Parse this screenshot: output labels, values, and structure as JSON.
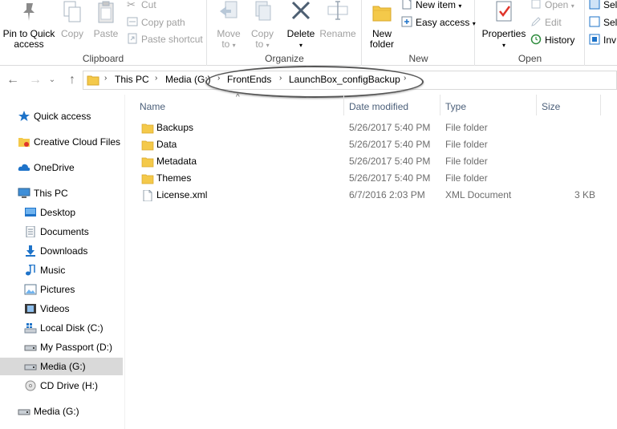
{
  "ribbon": {
    "clipboard": {
      "label": "Clipboard",
      "pin_line1": "Pin to Quick",
      "pin_line2": "access",
      "copy": "Copy",
      "paste": "Paste",
      "cut": "Cut",
      "copy_path": "Copy path",
      "paste_shortcut": "Paste shortcut"
    },
    "organize": {
      "label": "Organize",
      "move_to": "Move",
      "move_to2": "to",
      "copy_to": "Copy",
      "copy_to2": "to",
      "delete": "Delete",
      "rename": "Rename"
    },
    "new": {
      "label": "New",
      "new_folder1": "New",
      "new_folder2": "folder",
      "new_item": "New item",
      "easy_access": "Easy access"
    },
    "open": {
      "label": "Open",
      "properties": "Properties",
      "open": "Open",
      "edit": "Edit",
      "history": "History"
    },
    "select": {
      "select_all": "Sel",
      "select_none": "Sel",
      "invert": "Inv"
    }
  },
  "address": {
    "crumbs": [
      "This PC",
      "Media (G:)",
      "FrontEnds",
      "LaunchBox_configBackup"
    ]
  },
  "nav": {
    "items": [
      {
        "label": "Quick access",
        "icon": "star-icon"
      },
      {
        "label": "Creative Cloud Files",
        "icon": "creative-cloud-icon"
      },
      {
        "label": "OneDrive",
        "icon": "cloud-icon"
      },
      {
        "label": "This PC",
        "icon": "computer-icon"
      },
      {
        "label": "Desktop",
        "icon": "desktop-icon"
      },
      {
        "label": "Documents",
        "icon": "documents-icon"
      },
      {
        "label": "Downloads",
        "icon": "download-icon"
      },
      {
        "label": "Music",
        "icon": "music-icon"
      },
      {
        "label": "Pictures",
        "icon": "pictures-icon"
      },
      {
        "label": "Videos",
        "icon": "videos-icon"
      },
      {
        "label": "Local Disk (C:)",
        "icon": "windows-drive-icon"
      },
      {
        "label": "My Passport (D:)",
        "icon": "drive-icon"
      },
      {
        "label": "Media (G:)",
        "icon": "drive-icon"
      },
      {
        "label": "CD Drive (H:)",
        "icon": "cd-drive-icon"
      },
      {
        "label": "Media (G:)",
        "icon": "drive-icon"
      }
    ]
  },
  "files": {
    "columns": {
      "name": "Name",
      "date": "Date modified",
      "type": "Type",
      "size": "Size"
    },
    "rows": [
      {
        "name": "Backups",
        "date": "5/26/2017 5:40 PM",
        "type": "File folder",
        "size": ""
      },
      {
        "name": "Data",
        "date": "5/26/2017 5:40 PM",
        "type": "File folder",
        "size": ""
      },
      {
        "name": "Metadata",
        "date": "5/26/2017 5:40 PM",
        "type": "File folder",
        "size": ""
      },
      {
        "name": "Themes",
        "date": "5/26/2017 5:40 PM",
        "type": "File folder",
        "size": ""
      },
      {
        "name": "License.xml",
        "date": "6/7/2016 2:03 PM",
        "type": "XML Document",
        "size": "3 KB"
      }
    ]
  },
  "colors": {
    "folder": "#f4c94a",
    "accent": "#1e73c9",
    "selected": "#d9d9d9",
    "header_text": "#4c607a"
  }
}
